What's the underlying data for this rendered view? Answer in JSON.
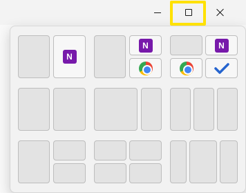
{
  "window": {
    "controls": {
      "minimize_icon": "minimize-icon",
      "maximize_icon": "maximize-icon",
      "close_icon": "close-icon"
    },
    "highlight_color": "#ffe100"
  },
  "snap_layouts": {
    "apps": {
      "onenote": {
        "icon": "onenote-icon",
        "glyph": "N",
        "color": "#7719aa"
      },
      "chrome": {
        "icon": "chrome-icon"
      },
      "todo": {
        "icon": "todo-icon",
        "color": "#2564cf"
      }
    }
  }
}
